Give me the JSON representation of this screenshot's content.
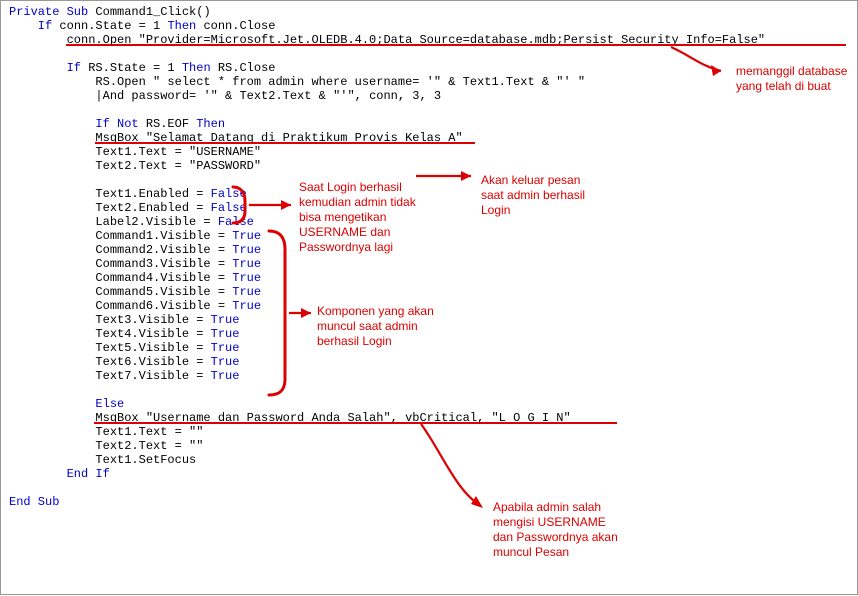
{
  "code": {
    "l1a": "Private Sub",
    "l1b": " Command1_Click()",
    "l2a": "    If",
    "l2b": " conn.State = 1 ",
    "l2c": "Then",
    "l2d": " conn.Close",
    "l3": "        conn.Open \"Provider=Microsoft.Jet.OLEDB.4.0;Data Source=database.mdb;Persist Security Info=False\"",
    "l5a": "        If",
    "l5b": " RS.State = 1 ",
    "l5c": "Then",
    "l5d": " RS.Close",
    "l6": "            RS.Open \" select * from admin where username= '\" & Text1.Text & \"' \"",
    "l7p": "            ",
    "l7cur": "|",
    "l7b": "And password= '\" & Text2.Text & \"'\", conn, 3, 3",
    "l9a": "            If Not",
    "l9b": " RS.EOF ",
    "l9c": "Then",
    "l10": "            MsgBox \"Selamat Datang di Praktikum Provis Kelas A\"",
    "l11": "            Text1.Text = \"USERNAME\"",
    "l12": "            Text2.Text = \"PASSWORD\"",
    "l14a": "            Text1.Enabled = ",
    "l14b": "False",
    "l15a": "            Text2.Enabled = ",
    "l15b": "False",
    "l16a": "            Label2.Visible = ",
    "l16b": "False",
    "l17a": "            Command1.Visible = ",
    "l17b": "True",
    "l18a": "            Command2.Visible = ",
    "l18b": "True",
    "l19a": "            Command3.Visible = ",
    "l19b": "True",
    "l20a": "            Command4.Visible = ",
    "l20b": "True",
    "l21a": "            Command5.Visible = ",
    "l21b": "True",
    "l22a": "            Command6.Visible = ",
    "l22b": "True",
    "l23a": "            Text3.Visible = ",
    "l23b": "True",
    "l24a": "            Text4.Visible = ",
    "l24b": "True",
    "l25a": "            Text5.Visible = ",
    "l25b": "True",
    "l26a": "            Text6.Visible = ",
    "l26b": "True",
    "l27a": "            Text7.Visible = ",
    "l27b": "True",
    "l29": "            Else",
    "l30": "            MsgBox \"Username dan Password Anda Salah\", vbCritical, \"L O G I N\"",
    "l31": "            Text1.Text = \"\"",
    "l32": "            Text2.Text = \"\"",
    "l33": "            Text1.SetFocus",
    "l34": "        End If",
    "l36": "End Sub"
  },
  "annotations": {
    "db": "memanggil database\nyang telah di buat",
    "login_success_msg": "Akan keluar pesan\nsaat admin berhasil\nLogin",
    "disable_fields": "Saat Login berhasil\nkemudian admin tidak\nbisa mengetikan\nUSERNAME dan\nPasswordnya lagi",
    "components": "Komponen yang akan\nmuncul saat admin\nberhasil Login",
    "wrong_pw": "Apabila admin salah\nmengisi USERNAME\ndan Passwordnya akan\nmuncul Pesan"
  }
}
